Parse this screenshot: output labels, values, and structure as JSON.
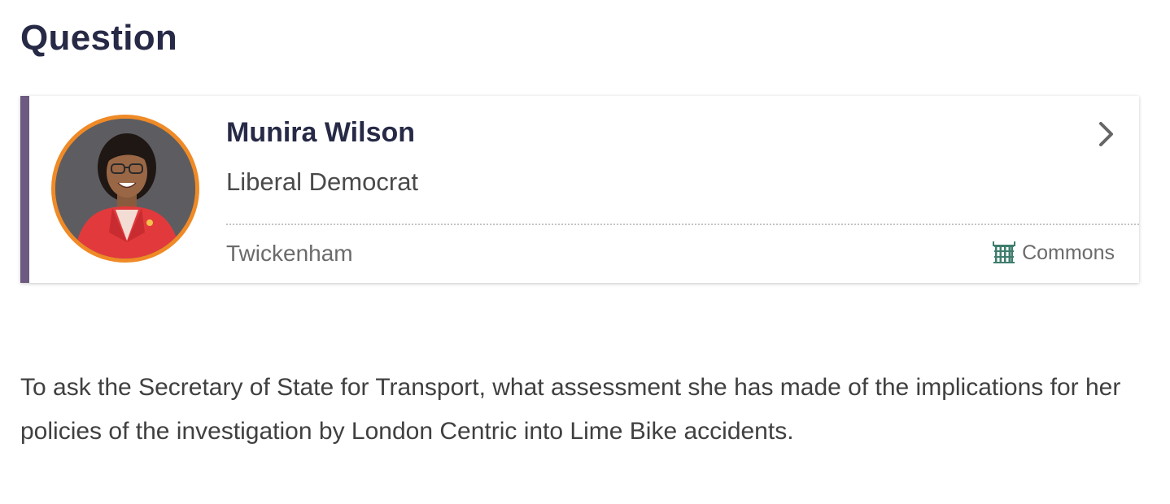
{
  "section": {
    "heading": "Question"
  },
  "member": {
    "name": "Munira Wilson",
    "party": "Liberal Democrat",
    "constituency": "Twickenham",
    "house": "Commons",
    "house_icon": "portcullis-icon",
    "party_color": "#ef8a26",
    "accent_color": "#6c5a80"
  },
  "question": {
    "text": "To ask the Secretary of State for Transport, what assessment she has made of the implications for her policies of the investigation by London Centric into Lime Bike accidents."
  }
}
